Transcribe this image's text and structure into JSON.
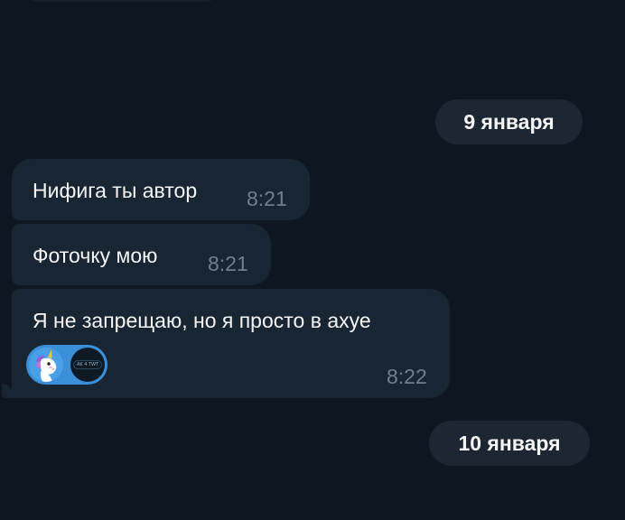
{
  "colors": {
    "background": "#0e1621",
    "bubble": "#182533",
    "date_pill": "#1c2733",
    "timestamp": "#6d7f8f",
    "reaction_badge": "#3a8fd8"
  },
  "date_separators": [
    {
      "label": "9 января"
    },
    {
      "label": "10 января"
    }
  ],
  "messages": [
    {
      "text": "Нифига ты автор",
      "time": "8:21"
    },
    {
      "text": "Фоточку мою",
      "time": "8:21"
    },
    {
      "text": "Я не запрещаю, но я просто в ахуе",
      "time": "8:22",
      "reactions": [
        {
          "icon": "unicorn-avatar-icon"
        },
        {
          "icon": "dark-profile-avatar-icon",
          "caption": "AK 4 TWT"
        }
      ]
    }
  ]
}
